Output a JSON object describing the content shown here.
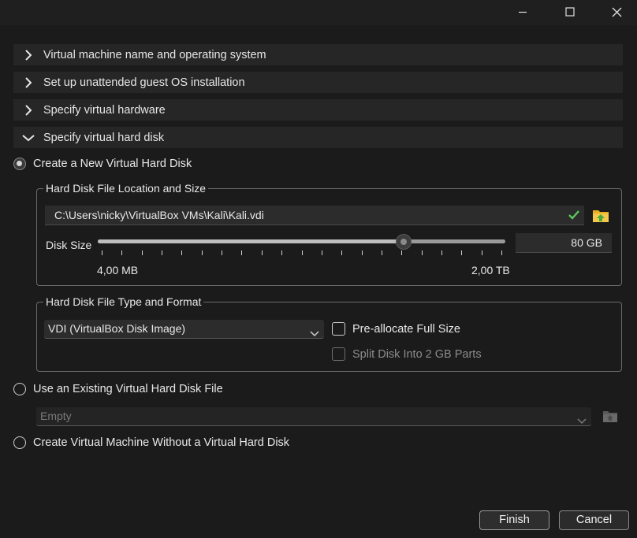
{
  "window": {
    "minimize_icon": "minimize-icon",
    "maximize_icon": "maximize-icon",
    "close_icon": "close-icon"
  },
  "sections": [
    {
      "label": "Virtual machine name and operating system",
      "expanded": false
    },
    {
      "label": "Set up unattended guest OS installation",
      "expanded": false
    },
    {
      "label": "Specify virtual hardware",
      "expanded": false
    },
    {
      "label": "Specify virtual hard disk",
      "expanded": true
    }
  ],
  "hard_disk": {
    "option_new": "Create a New Virtual Hard Disk",
    "location_group": {
      "title": "Hard Disk File Location and Size",
      "path": "C:\\Users\\nicky\\VirtualBox VMs\\Kali\\Kali.vdi",
      "valid_icon": "checkmark-icon",
      "browse_icon": "folder-icon",
      "disk_size_label": "Disk Size",
      "slider_min_label": "4,00 MB",
      "slider_max_label": "2,00 TB",
      "slider_position_fraction": 0.75,
      "disk_size_value": "80 GB"
    },
    "format_group": {
      "title": "Hard Disk File Type and Format",
      "format_selected": "VDI (VirtualBox Disk Image)",
      "preallocate_label": "Pre-allocate Full Size",
      "preallocate_checked": false,
      "split_label": "Split Disk Into 2 GB Parts",
      "split_checked": false,
      "split_enabled": false
    },
    "option_existing": "Use an Existing Virtual Hard Disk File",
    "existing_select_value": "Empty",
    "option_none": "Create Virtual Machine Without a Virtual Hard Disk"
  },
  "buttons": {
    "finish": "Finish",
    "cancel": "Cancel"
  },
  "colors": {
    "background": "#1b1b1b",
    "section_bg": "#262626",
    "check_green": "#5ac85a",
    "folder_yellow": "#e8b020"
  }
}
